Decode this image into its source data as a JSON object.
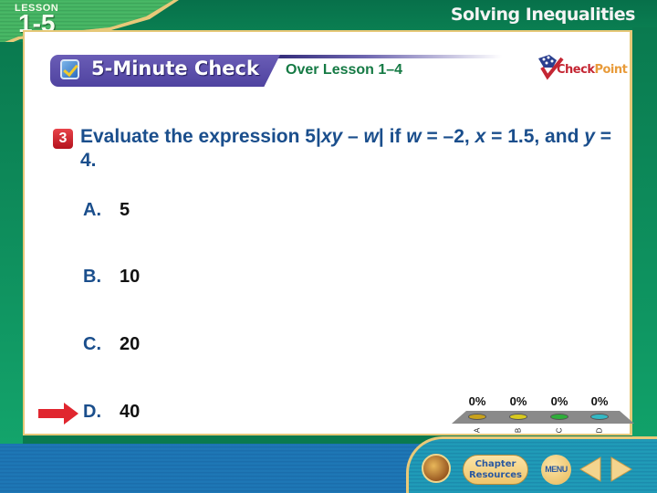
{
  "header": {
    "lesson_label": "LESSON",
    "lesson_number": "1-5",
    "title": "Solving Inequalities"
  },
  "check_bar": {
    "title": "5-Minute Check",
    "subtitle": "Over Lesson 1–4",
    "icon": "checkbox-icon"
  },
  "logo": {
    "check": "Check",
    "point": "Point"
  },
  "question": {
    "number": "3",
    "text_parts": {
      "p1": "Evaluate the expression 5|",
      "xy": "xy",
      "p2": " – ",
      "w1": "w",
      "p3": "| if ",
      "w2": "w",
      "p4": " = –2, ",
      "x": "x",
      "p5": " = 1.5, and ",
      "y": "y",
      "p6": " = 4."
    }
  },
  "answers": [
    {
      "letter": "A.",
      "value": "5"
    },
    {
      "letter": "B.",
      "value": "10"
    },
    {
      "letter": "C.",
      "value": "20"
    },
    {
      "letter": "D.",
      "value": "40"
    }
  ],
  "correct_answer": "D",
  "poll": {
    "results": [
      {
        "label": "A",
        "percent": "0%",
        "color": "#c9a21c"
      },
      {
        "label": "B",
        "percent": "0%",
        "color": "#d8c91e"
      },
      {
        "label": "C",
        "percent": "0%",
        "color": "#2fae3a"
      },
      {
        "label": "D",
        "percent": "0%",
        "color": "#33b8c4"
      }
    ]
  },
  "footer": {
    "chapter_resources": "Chapter Resources",
    "menu": "MENU"
  },
  "colors": {
    "header_green": "#0a7a4f",
    "check_bar_purple": "#5a4eaa",
    "question_blue": "#1a4e8c",
    "arrow_red": "#e0262f",
    "gold_border": "#e6c878"
  }
}
